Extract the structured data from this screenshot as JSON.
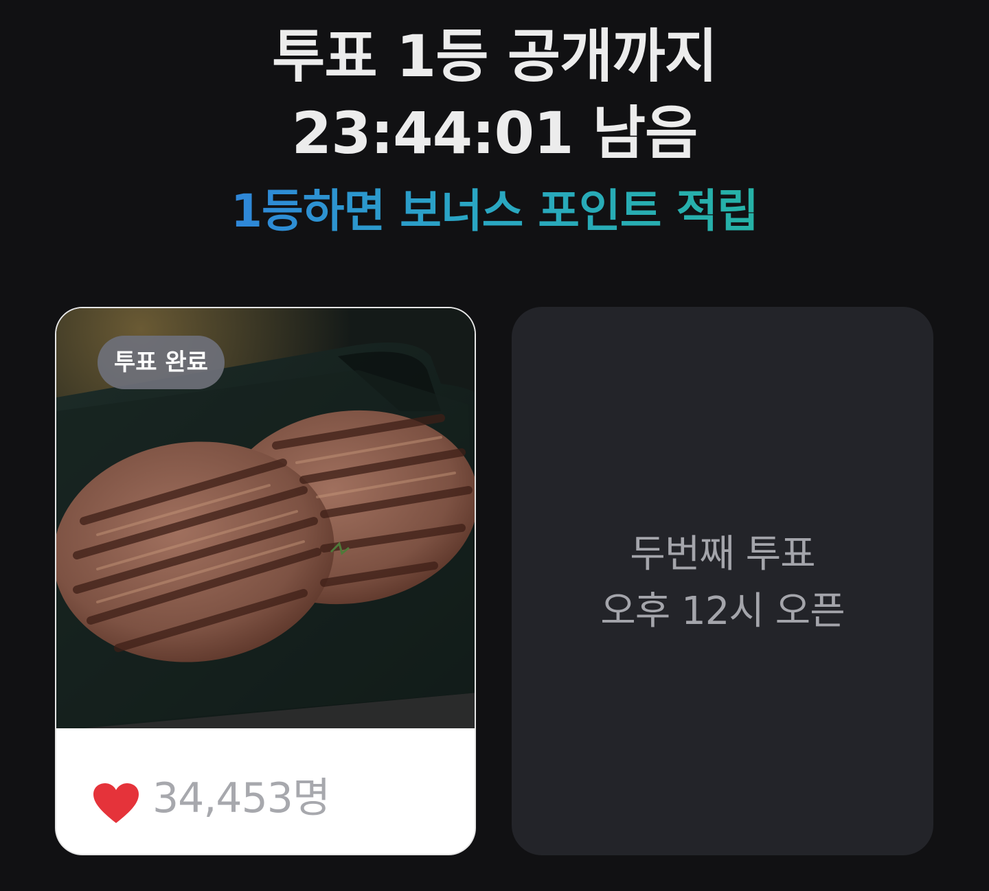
{
  "header": {
    "title_line1": "투표 1등 공개까지",
    "countdown_line": "23:44:01 남음",
    "subtitle": "1등하면 보너스 포인트 적립"
  },
  "vote_card": {
    "badge": "투표 완료",
    "image_alt": "그릴 자국이 있는 함박 스테이크 두 장",
    "likes_icon": "heart-icon",
    "likes_count": "34,453명"
  },
  "next_card": {
    "line1": "두번째 투표",
    "line2": "오후 12시 오픈"
  },
  "colors": {
    "background": "#111113",
    "title": "#ececec",
    "subtitle_gradient_start": "#2f86d9",
    "subtitle_gradient_end": "#26b2a6",
    "heart": "#e5333a",
    "next_card_bg": "#232429"
  }
}
